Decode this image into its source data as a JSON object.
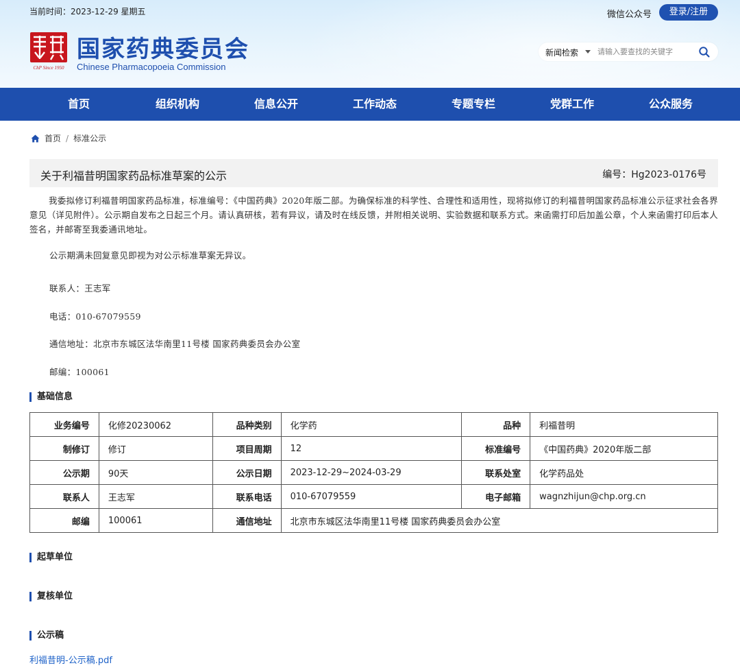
{
  "topbar": {
    "current_time": "当前时间：2023-12-29 星期五",
    "wechat": "微信公众号",
    "login": "登录/注册"
  },
  "brand": {
    "name_cn": "国家药典委员会",
    "name_en": "Chinese Pharmacopoeia Commission",
    "seal_caption": "ChP Since 1950",
    "brand_color": "#1e4fae",
    "seal_color": "#c8161d"
  },
  "search": {
    "category": "新闻检索",
    "placeholder": "请输入要查找的关键字"
  },
  "nav": [
    "首页",
    "组织机构",
    "信息公开",
    "工作动态",
    "专题专栏",
    "党群工作",
    "公众服务"
  ],
  "breadcrumb": {
    "home": "首页",
    "separator": "/",
    "current": "标准公示"
  },
  "article": {
    "title": "关于利福昔明国家药品标准草案的公示",
    "number": "编号：Hg2023-0176号",
    "paragraph1": "我委拟修订利福昔明国家药品标准，标准编号：《中国药典》2020年版二部。为确保标准的科学性、合理性和适用性，现将拟修订的利福昔明国家药品标准公示征求社会各界意见（详见附件）。公示期自发布之日起三个月。请认真研核，若有异议，请及时在线反馈，并附相关说明、实验数据和联系方式。来函需打印后加盖公章，个人来函需打印后本人签名，并邮寄至我委通讯地址。",
    "paragraph2": "公示期满未回复意见即视为对公示标准草案无异议。",
    "contact": "联系人：王志军",
    "phone": "电话：010-67079559",
    "address": "通信地址：北京市东城区法华南里11号楼 国家药典委员会办公室",
    "postcode": "邮编：100061"
  },
  "sections": {
    "basic_info": "基础信息",
    "drafting_unit": "起草单位",
    "review_unit": "复核单位",
    "publicity_draft": "公示稿"
  },
  "info_table": {
    "rows": [
      [
        [
          "业务编号",
          "化修20230062"
        ],
        [
          "品种类别",
          "化学药"
        ],
        [
          "品种",
          "利福昔明"
        ]
      ],
      [
        [
          "制修订",
          "修订"
        ],
        [
          "项目周期",
          "12"
        ],
        [
          "标准编号",
          "《中国药典》2020年版二部"
        ]
      ],
      [
        [
          "公示期",
          "90天"
        ],
        [
          "公示日期",
          "2023-12-29~2024-03-29"
        ],
        [
          "联系处室",
          "化学药品处"
        ]
      ],
      [
        [
          "联系人",
          "王志军"
        ],
        [
          "联系电话",
          "010-67079559"
        ],
        [
          "电子邮箱",
          "wagnzhijun@chp.org.cn"
        ]
      ]
    ],
    "last_row": {
      "postcode_label": "邮编",
      "postcode_value": "100061",
      "address_label": "通信地址",
      "address_value": "北京市东城区法华南里11号楼 国家药典委员会办公室"
    }
  },
  "attachment": {
    "file_name": "利福昔明-公示稿.pdf"
  }
}
